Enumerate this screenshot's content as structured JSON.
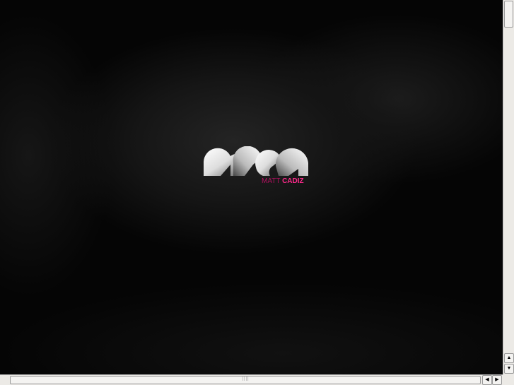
{
  "logo": {
    "monogram": "mca",
    "name_first": "MATT",
    "name_last": "CADIZ",
    "accent": "#ff2a8c"
  },
  "scrollbars": {
    "up_arrow": "▲",
    "down_arrow": "▼",
    "left_arrow": "◀",
    "right_arrow": "▶",
    "grip": "⠿⠿"
  }
}
